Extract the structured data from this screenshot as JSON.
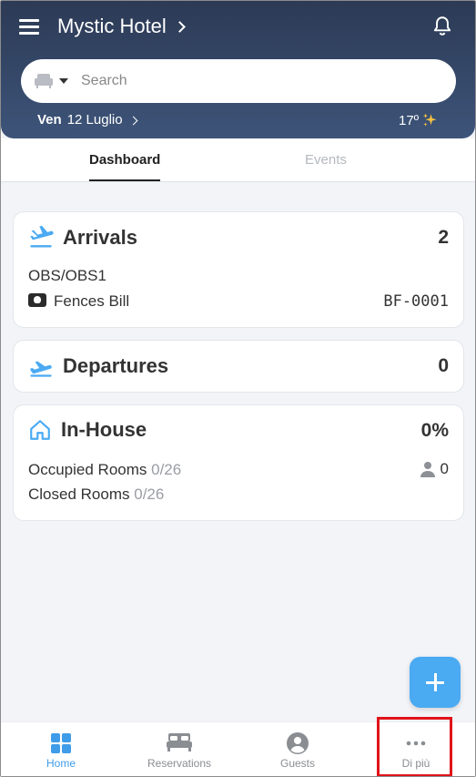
{
  "header": {
    "title": "Mystic Hotel",
    "search_placeholder": "Search",
    "date_day": "Ven",
    "date_rest": "12 Luglio",
    "temperature": "17º",
    "weather_icon": "sparkles-icon"
  },
  "tabs": [
    {
      "label": "Dashboard",
      "active": true
    },
    {
      "label": "Events",
      "active": false
    }
  ],
  "arrivals": {
    "title": "Arrivals",
    "count": "2",
    "group": "OBS/OBS1",
    "guest_name": "Fences Bill",
    "code": "BF-0001"
  },
  "departures": {
    "title": "Departures",
    "count": "0"
  },
  "inhouse": {
    "title": "In-House",
    "percent": "0%",
    "occupied_label": "Occupied Rooms",
    "occupied_value": "0/26",
    "closed_label": "Closed Rooms",
    "closed_value": "0/26",
    "persons": "0"
  },
  "bottom_nav": [
    {
      "label": "Home",
      "icon": "grid-icon",
      "active": true
    },
    {
      "label": "Reservations",
      "icon": "bed-icon",
      "active": false
    },
    {
      "label": "Guests",
      "icon": "user-circle-icon",
      "active": false
    },
    {
      "label": "Di più",
      "icon": "more-dots-icon",
      "active": false
    }
  ],
  "colors": {
    "header_top": "#2c3a55",
    "header_bottom": "#3d5479",
    "accent": "#4aaaf2",
    "highlight": "#e0141a"
  }
}
